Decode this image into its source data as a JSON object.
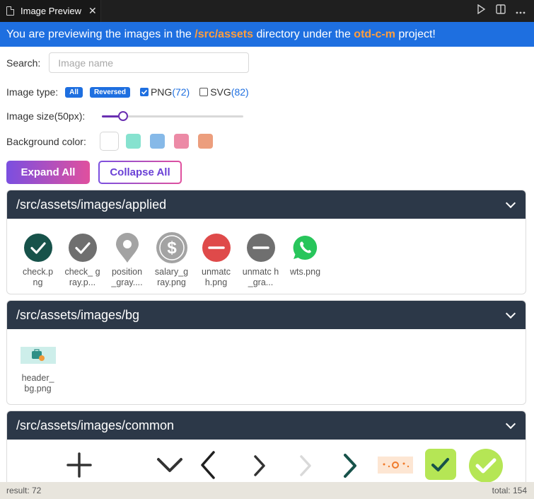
{
  "tab": {
    "title": "Image Preview",
    "close": "✕"
  },
  "banner": {
    "prefix": "You are previewing the images in the ",
    "dir": "/src/assets",
    "middle": " directory under the ",
    "project": "otd-c-m",
    "suffix": " project!"
  },
  "search": {
    "label": "Search:",
    "placeholder": "Image name",
    "value": ""
  },
  "image_type": {
    "label": "Image type:",
    "all": "All",
    "reversed": "Reversed",
    "png_label": "PNG",
    "png_count": "(72)",
    "png_checked": true,
    "svg_label": "SVG",
    "svg_count": "(82)",
    "svg_checked": false
  },
  "image_size": {
    "label": "Image size(50px):",
    "level": 0.12
  },
  "background": {
    "label": "Background color:",
    "colors": [
      "#ffffff",
      "#86e2cf",
      "#86b9e8",
      "#ec8aa6",
      "#ec9e7d"
    ]
  },
  "buttons": {
    "expand": "Expand All",
    "collapse": "Collapse All"
  },
  "groups": [
    {
      "title": "/src/assets/images/applied",
      "items": [
        {
          "name": "check.p ng",
          "icon": "check-dark-circle-icon"
        },
        {
          "name": "check_ gray.p...",
          "icon": "check-gray-circle-icon"
        },
        {
          "name": "position _gray....",
          "icon": "location-pin-gray-icon"
        },
        {
          "name": "salary_g ray.png",
          "icon": "dollar-gray-circle-icon"
        },
        {
          "name": "unmatc h.png",
          "icon": "minus-red-circle-icon"
        },
        {
          "name": "unmatc h_gra...",
          "icon": "minus-gray-circle-icon"
        },
        {
          "name": "wts.png",
          "icon": "whatsapp-icon"
        }
      ]
    },
    {
      "title": "/src/assets/images/bg",
      "items": [
        {
          "name": "header_ bg.png",
          "icon": "header-bg-icon"
        }
      ]
    },
    {
      "title": "/src/assets/images/common",
      "items": []
    }
  ],
  "status": {
    "result": "result: 72",
    "total": "total: 154"
  },
  "colors": {
    "accent": "#1e6fe0",
    "highlight": "#ff9e3d",
    "group_header": "#2c3848",
    "slider": "#6a2fb1"
  }
}
